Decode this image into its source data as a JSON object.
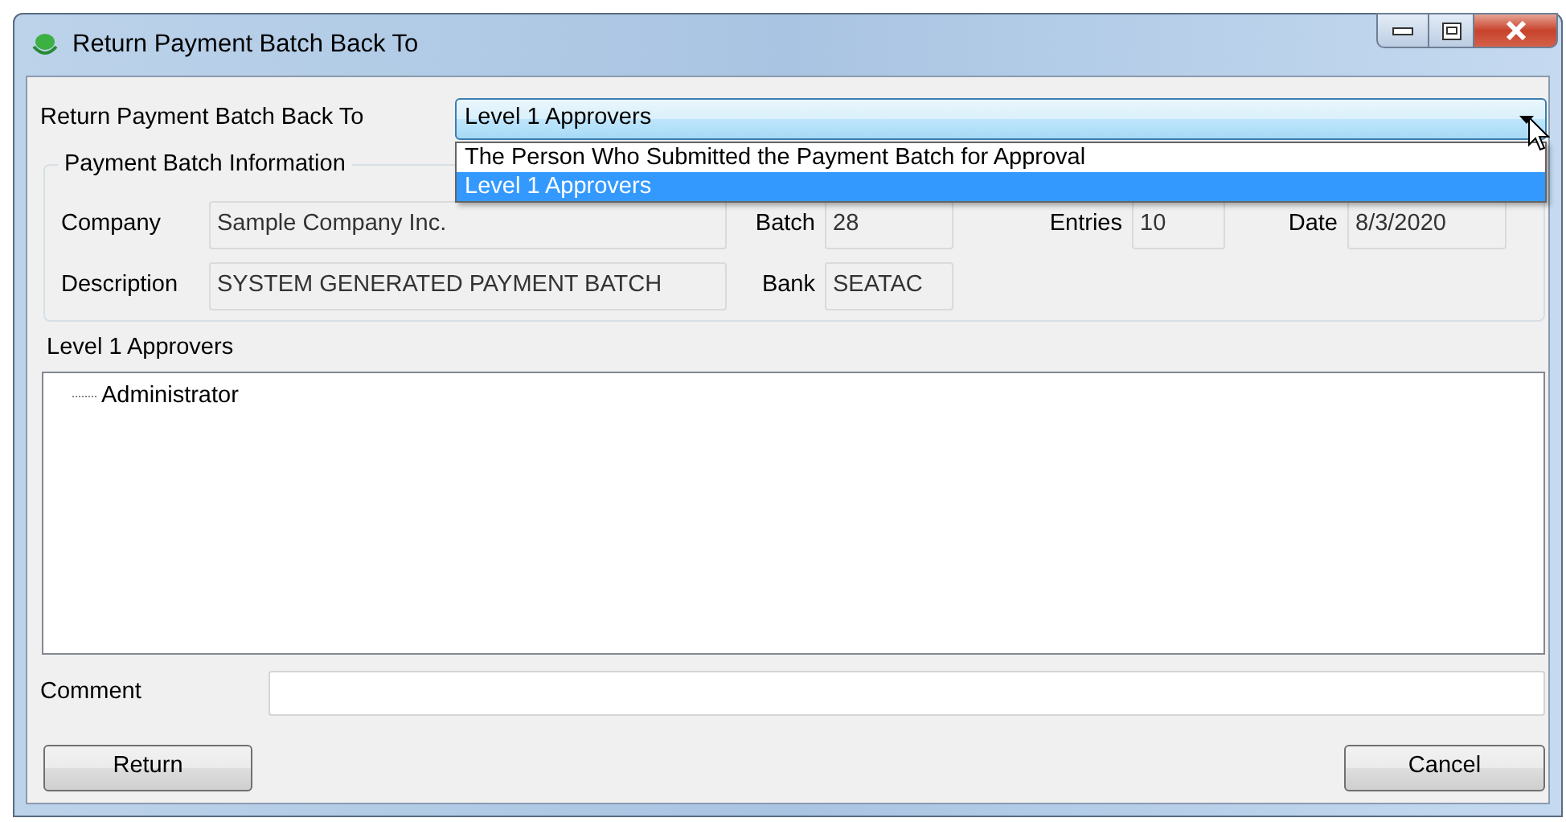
{
  "window": {
    "title": "Return Payment Batch Back To"
  },
  "return_to": {
    "label": "Return Payment Batch Back To",
    "value": "Level 1 Approvers",
    "expanded": true,
    "options": [
      {
        "label": "The Person Who Submitted the Payment Batch for Approval",
        "selected": false
      },
      {
        "label": "Level 1 Approvers",
        "selected": true
      }
    ]
  },
  "batch_info": {
    "title": "Payment Batch Information",
    "rows": [
      [
        {
          "label": "Company",
          "value": "Sample Company Inc."
        },
        {
          "label": "Batch",
          "value": "28"
        },
        {
          "label": "Entries",
          "value": "10"
        },
        {
          "label": "Date",
          "value": "8/3/2020"
        }
      ],
      [
        {
          "label": "Description",
          "value": "SYSTEM GENERATED PAYMENT BATCH"
        },
        {
          "label": "Bank",
          "value": "SEATAC"
        }
      ]
    ]
  },
  "approvers": {
    "label": "Level 1 Approvers",
    "items": [
      {
        "label": "Administrator"
      }
    ]
  },
  "comment": {
    "label": "Comment"
  },
  "buttons": [
    {
      "label": "Return"
    },
    {
      "label": "Cancel"
    }
  ]
}
